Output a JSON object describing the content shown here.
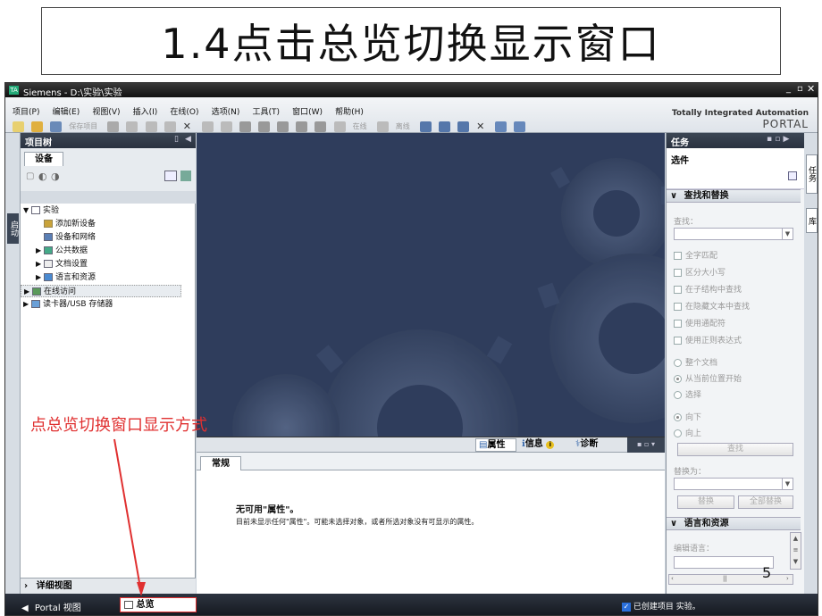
{
  "slide": {
    "title": "1.4点击总览切换显示窗口",
    "annotation": "点总览切换窗口显示方式",
    "page_number": "5"
  },
  "app": {
    "window_title": "Siemens - D:\\实验\\实验",
    "brand_line1": "Totally Integrated Automation",
    "brand_line2": "PORTAL",
    "menu": [
      "项目(P)",
      "编辑(E)",
      "视图(V)",
      "插入(I)",
      "在线(O)",
      "选项(N)",
      "工具(T)",
      "窗口(W)",
      "帮助(H)"
    ],
    "toolbar": {
      "save_label": "保存项目",
      "online_label": "在线",
      "offline_label": "离线"
    }
  },
  "project_tree": {
    "header": "项目树",
    "tab": "设备",
    "side_tab": "启动",
    "items": [
      {
        "label": "实验",
        "icon": "project-icon"
      },
      {
        "label": "添加新设备",
        "icon": "add-device-icon"
      },
      {
        "label": "设备和网络",
        "icon": "network-icon"
      },
      {
        "label": "公共数据",
        "icon": "folder-icon"
      },
      {
        "label": "文档设置",
        "icon": "document-icon"
      },
      {
        "label": "语言和资源",
        "icon": "language-icon"
      },
      {
        "label": "在线访问",
        "icon": "online-icon"
      },
      {
        "label": "读卡器/USB 存储器",
        "icon": "usb-icon"
      }
    ],
    "details_view": "详细视图"
  },
  "inspector": {
    "tabs": {
      "properties": "属性",
      "info": "信息",
      "diagnostics": "诊断"
    },
    "general_tab": "常规",
    "no_props_title": "无可用\"属性\"。",
    "no_props_desc": "目前未显示任何\"属性\"。可能未选择对象，或者所选对象没有可显示的属性。"
  },
  "tasks": {
    "header": "任务",
    "options_label": "选件",
    "side_tab1": "任务",
    "side_tab2": "库",
    "find_replace_header": "查找和替换",
    "find_label": "查找：",
    "checkboxes": [
      "全字匹配",
      "区分大小写",
      "在子结构中查找",
      "在隐藏文本中查找",
      "使用通配符",
      "使用正则表达式"
    ],
    "scope_radios": [
      "整个文档",
      "从当前位置开始",
      "选择"
    ],
    "direction_radios": [
      "向下",
      "向上"
    ],
    "find_button": "查找",
    "replace_label": "替换为：",
    "replace_button": "替换",
    "replace_all_button": "全部替换",
    "lang_header": "语言和资源",
    "edit_lang_label": "编辑语言："
  },
  "statusbar": {
    "portal_view": "Portal 视图",
    "overview": "总览",
    "status_msg": "已创建项目 实验。"
  },
  "colors": {
    "workspace": "#2f3d5c",
    "annotation": "#e03030",
    "panel_header": "#2f3844"
  }
}
